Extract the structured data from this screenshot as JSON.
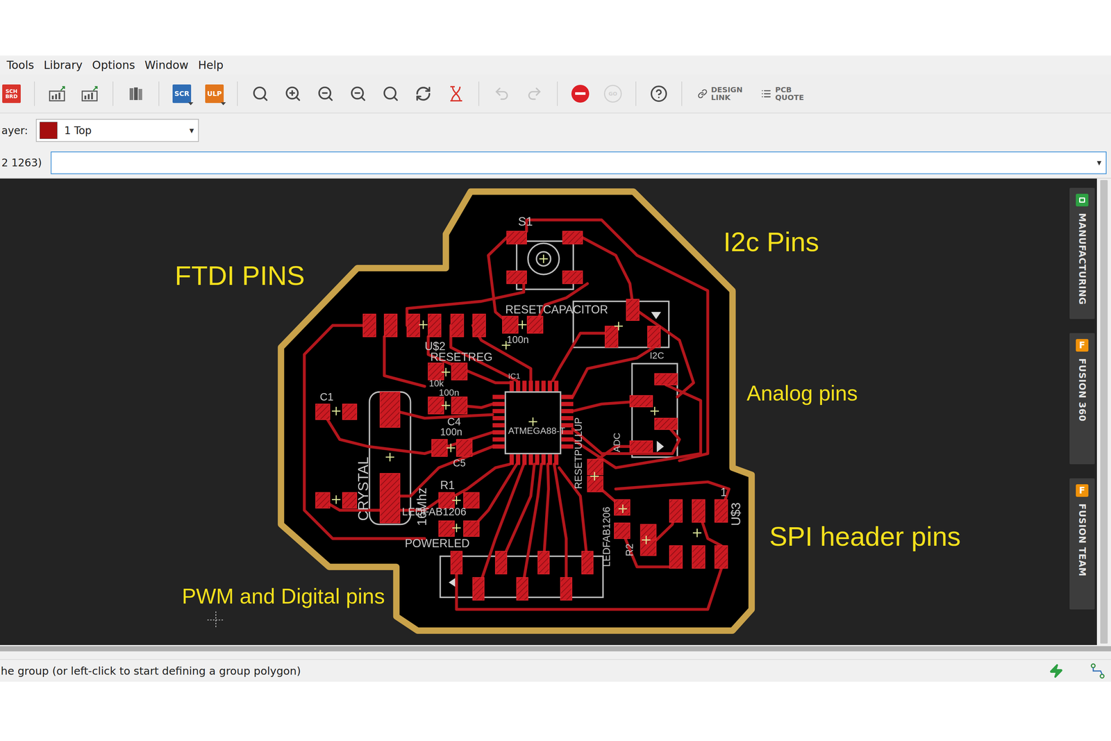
{
  "menu": [
    "Tools",
    "Library",
    "Options",
    "Window",
    "Help"
  ],
  "toolbar": {
    "sch_brd": [
      "SCH",
      "BRD"
    ],
    "script": "SCR",
    "ulp": "ULP",
    "go": "GO",
    "help_disabled": false,
    "undo_disabled": true,
    "redo_disabled": true,
    "go_disabled": true,
    "design_link": [
      "DESIGN",
      "LINK"
    ],
    "pcb_quote": [
      "PCB",
      "QUOTE"
    ]
  },
  "layer": {
    "label": "ayer:",
    "value": "1 Top",
    "color": "#a50f0f",
    "arrow": "▾"
  },
  "coordinates": "2 1263)",
  "command": {
    "value": "",
    "arrow": "▾"
  },
  "annotations": [
    {
      "text": "FTDI PINS"
    },
    {
      "text": "I2c Pins"
    },
    {
      "text": "Analog pins"
    },
    {
      "text": "SPI header pins"
    },
    {
      "text": "PWM and Digital pins"
    }
  ],
  "silkscreen": [
    "S1",
    "RESETCAPACITOR",
    "U$2",
    "RESETREG",
    "100n",
    "IC1",
    "C1",
    "10k",
    "100n",
    "C4",
    "100n",
    "C5",
    "ATMEGA88-T",
    "CRYSTAL",
    "16Mhz",
    "R1",
    "LEDFAB1206",
    "POWERLED",
    "RESETPULLUP",
    "LEDFAB1206",
    "R2",
    "U$3",
    "1",
    "I2C",
    "ADC"
  ],
  "side_tabs": [
    {
      "label": "MANUFACTURING",
      "icon_text": "",
      "color": "#2ea043"
    },
    {
      "label": "FUSION 360",
      "icon_text": "F",
      "color": "#f0920a"
    },
    {
      "label": "FUSION TEAM",
      "icon_text": "F",
      "color": "#f0920a"
    }
  ],
  "status": "he group (or left-click to start defining a group polygon)"
}
